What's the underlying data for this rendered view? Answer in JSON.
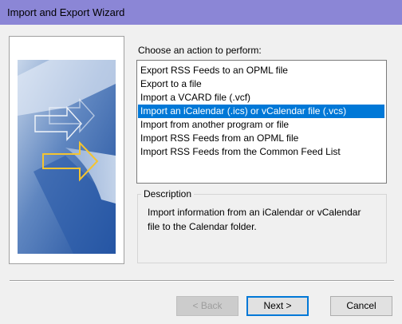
{
  "window": {
    "title": "Import and Export Wizard"
  },
  "prompt_label": "Choose an action to perform:",
  "actions": [
    {
      "label": "Export RSS Feeds to an OPML file",
      "selected": false
    },
    {
      "label": "Export to a file",
      "selected": false
    },
    {
      "label": "Import a VCARD file (.vcf)",
      "selected": false
    },
    {
      "label": "Import an iCalendar (.ics) or vCalendar file (.vcs)",
      "selected": true
    },
    {
      "label": "Import from another program or file",
      "selected": false
    },
    {
      "label": "Import RSS Feeds from an OPML file",
      "selected": false
    },
    {
      "label": "Import RSS Feeds from the Common Feed List",
      "selected": false
    }
  ],
  "description": {
    "legend": "Description",
    "text": "Import information from an iCalendar or vCalendar file to the Calendar folder."
  },
  "buttons": {
    "back": "< Back",
    "next": "Next >",
    "cancel": "Cancel"
  },
  "colors": {
    "titlebar": "#8b86d6",
    "selection": "#0078d7",
    "window_bg": "#f0f0f0"
  }
}
